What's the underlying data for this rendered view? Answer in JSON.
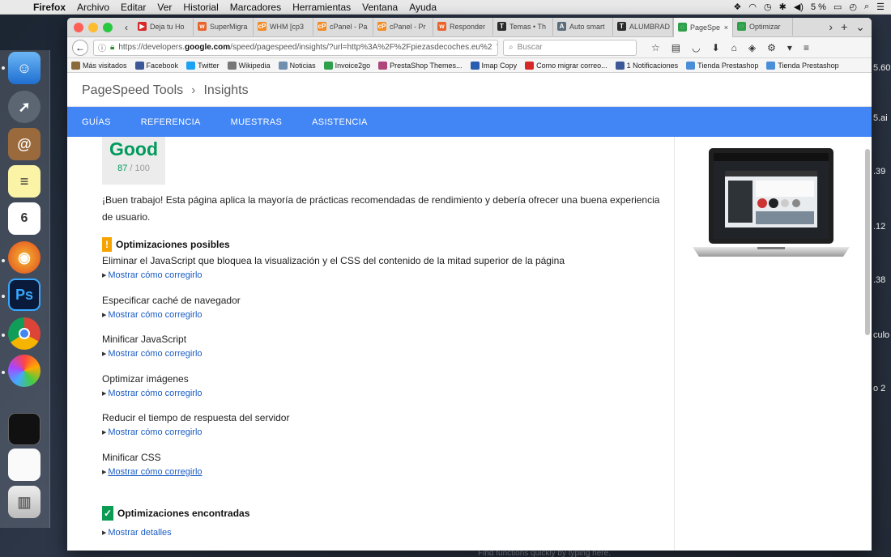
{
  "menubar": {
    "app": "Firefox",
    "items": [
      "Archivo",
      "Editar",
      "Ver",
      "Historial",
      "Marcadores",
      "Herramientas",
      "Ventana",
      "Ayuda"
    ],
    "battery": "5 %"
  },
  "tabs": [
    {
      "label": "Deja tu Ho",
      "color": "#d62828",
      "glyph": "▶"
    },
    {
      "label": "SuperMigra",
      "color": "#e8642b",
      "glyph": "w"
    },
    {
      "label": "WHM [cp3",
      "color": "#f28b25",
      "glyph": "cP"
    },
    {
      "label": "cPanel - Pa",
      "color": "#f28b25",
      "glyph": "cP"
    },
    {
      "label": "cPanel - Pr",
      "color": "#f28b25",
      "glyph": "cP"
    },
    {
      "label": "Responder",
      "color": "#e8642b",
      "glyph": "w"
    },
    {
      "label": "Temas • Th",
      "color": "#2b2b2b",
      "glyph": "T"
    },
    {
      "label": "Auto smart",
      "color": "#5a6b7a",
      "glyph": "A"
    },
    {
      "label": "ALUMBRAD",
      "color": "#2b2b2b",
      "glyph": "T"
    },
    {
      "label": "PageSpe",
      "color": "#2ea04a",
      "glyph": "◌",
      "active": true
    },
    {
      "label": "Optimizar",
      "color": "#2ea04a",
      "glyph": "◌"
    }
  ],
  "url": {
    "prefix": "https://developers.",
    "domain": "google.com",
    "rest": "/speed/pagespeed/insights/?url=http%3A%2F%2Fpiezasdecoches.eu%2"
  },
  "search_placeholder": "Buscar",
  "bookmarks": [
    {
      "label": "Más visitados",
      "color": "#8a6a3a"
    },
    {
      "label": "Facebook",
      "color": "#3b5998"
    },
    {
      "label": "Twitter",
      "color": "#1da1f2"
    },
    {
      "label": "Wikipedia",
      "color": "#777777"
    },
    {
      "label": "Noticias",
      "color": "#6f8faf"
    },
    {
      "label": "Invoice2go",
      "color": "#2ea04a"
    },
    {
      "label": "PrestaShop Themes...",
      "color": "#b0477a"
    },
    {
      "label": "Imap Copy",
      "color": "#2a5db0"
    },
    {
      "label": "Como migrar correo...",
      "color": "#d62828"
    },
    {
      "label": "1 Notificaciones",
      "color": "#3b5998"
    },
    {
      "label": "Tienda Prestashop",
      "color": "#4a8ed8"
    },
    {
      "label": "Tienda Prestashop",
      "color": "#4a8ed8"
    }
  ],
  "pagespeed": {
    "breadcrumb_root": "PageSpeed Tools",
    "breadcrumb_current": "Insights",
    "nav": [
      "GUÍAS",
      "REFERENCIA",
      "MUESTRAS",
      "ASISTENCIA"
    ],
    "score_label": "Good",
    "score": 87,
    "score_of": "/ 100",
    "summary": "¡Buen trabajo! Esta página aplica la mayoría de prácticas recomendadas de rendimiento y debería ofrecer una buena experiencia de usuario.",
    "possible_title": "Optimizaciones posibles",
    "optimizations": [
      {
        "title": "Eliminar el JavaScript que bloquea la visualización y el CSS del contenido de la mitad superior de la página",
        "link": "Mostrar cómo corregirlo"
      },
      {
        "title": "Especificar caché de navegador",
        "link": "Mostrar cómo corregirlo"
      },
      {
        "title": "Minificar JavaScript",
        "link": "Mostrar cómo corregirlo"
      },
      {
        "title": "Optimizar imágenes",
        "link": "Mostrar cómo corregirlo"
      },
      {
        "title": "Reducir el tiempo de respuesta del servidor",
        "link": "Mostrar cómo corregirlo"
      },
      {
        "title": "Minificar CSS",
        "link": "Mostrar cómo corregirlo"
      }
    ],
    "found_title": "Optimizaciones encontradas",
    "found_link": "Mostrar detalles"
  },
  "colors": {
    "accent": "#4285f4",
    "good": "#009a5c",
    "warning": "#f6a300",
    "success": "#0b9b52",
    "link": "#1a5bc4"
  },
  "background_right": [
    "5.60",
    "5.ai",
    ".39",
    ".12",
    ".38",
    "culo",
    "o 2"
  ],
  "background_bottom": "Find functions quickly by typing here."
}
